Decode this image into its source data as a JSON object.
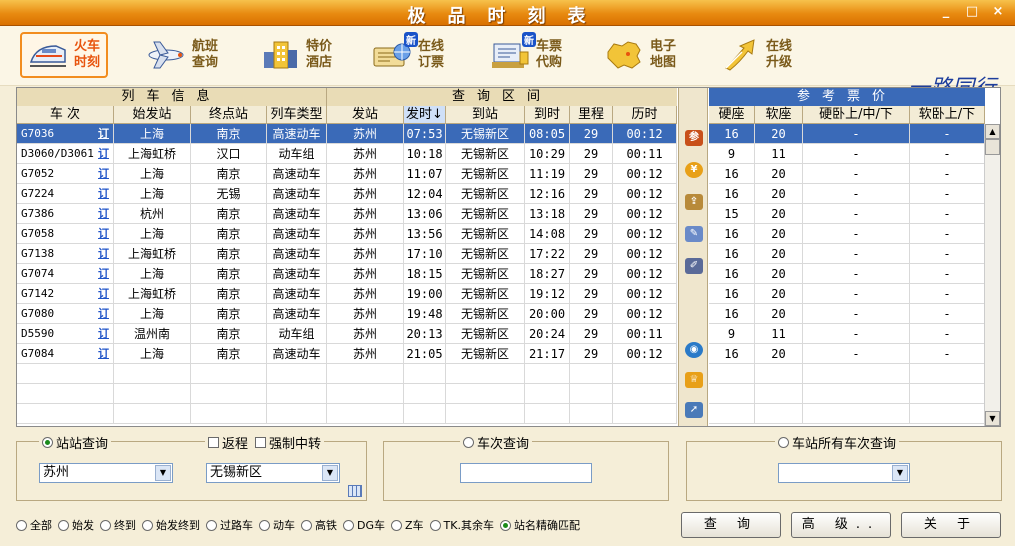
{
  "window": {
    "title": "极品时刻表",
    "controls": [
      "_",
      "□",
      "×"
    ]
  },
  "toolbar": [
    {
      "line1": "火车",
      "line2": "时刻",
      "icon": "train-icon",
      "active": true
    },
    {
      "line1": "航班",
      "line2": "查询",
      "icon": "airplane-icon"
    },
    {
      "line1": "特价",
      "line2": "酒店",
      "icon": "hotel-icon"
    },
    {
      "line1": "在线",
      "line2": "订票",
      "icon": "ticket-icon",
      "badge": "新"
    },
    {
      "line1": "车票",
      "line2": "代购",
      "icon": "cashier-icon",
      "badge": "新"
    },
    {
      "line1": "电子",
      "line2": "地图",
      "icon": "china-map-icon"
    },
    {
      "line1": "在线",
      "line2": "升级",
      "icon": "upgrade-arrow-icon"
    }
  ],
  "signature": "一路同行",
  "table": {
    "group_train": "列车信息",
    "group_query": "查询区间",
    "group_price": "参考票价",
    "columns": [
      "车 次",
      "始发站",
      "终点站",
      "列车类型",
      "发站",
      "发时↓",
      "到站",
      "到时",
      "里程",
      "历时"
    ],
    "price_columns": [
      "硬座",
      "软座",
      "硬卧上/中/下",
      "软卧上/下"
    ],
    "ding_label": "订",
    "rows": [
      [
        "G7036",
        "上海",
        "南京",
        "高速动车",
        "苏州",
        "07:53",
        "无锡新区",
        "08:05",
        "29",
        "00:12",
        "16",
        "20",
        "-",
        "-"
      ],
      [
        "D3060/D3061",
        "上海虹桥",
        "汉口",
        "动车组",
        "苏州",
        "10:18",
        "无锡新区",
        "10:29",
        "29",
        "00:11",
        "9",
        "11",
        "-",
        "-"
      ],
      [
        "G7052",
        "上海",
        "南京",
        "高速动车",
        "苏州",
        "11:07",
        "无锡新区",
        "11:19",
        "29",
        "00:12",
        "16",
        "20",
        "-",
        "-"
      ],
      [
        "G7224",
        "上海",
        "无锡",
        "高速动车",
        "苏州",
        "12:04",
        "无锡新区",
        "12:16",
        "29",
        "00:12",
        "16",
        "20",
        "-",
        "-"
      ],
      [
        "G7386",
        "杭州",
        "南京",
        "高速动车",
        "苏州",
        "13:06",
        "无锡新区",
        "13:18",
        "29",
        "00:12",
        "15",
        "20",
        "-",
        "-"
      ],
      [
        "G7058",
        "上海",
        "南京",
        "高速动车",
        "苏州",
        "13:56",
        "无锡新区",
        "14:08",
        "29",
        "00:12",
        "16",
        "20",
        "-",
        "-"
      ],
      [
        "G7138",
        "上海虹桥",
        "南京",
        "高速动车",
        "苏州",
        "17:10",
        "无锡新区",
        "17:22",
        "29",
        "00:12",
        "16",
        "20",
        "-",
        "-"
      ],
      [
        "G7074",
        "上海",
        "南京",
        "高速动车",
        "苏州",
        "18:15",
        "无锡新区",
        "18:27",
        "29",
        "00:12",
        "16",
        "20",
        "-",
        "-"
      ],
      [
        "G7142",
        "上海虹桥",
        "南京",
        "高速动车",
        "苏州",
        "19:00",
        "无锡新区",
        "19:12",
        "29",
        "00:12",
        "16",
        "20",
        "-",
        "-"
      ],
      [
        "G7080",
        "上海",
        "南京",
        "高速动车",
        "苏州",
        "19:48",
        "无锡新区",
        "20:00",
        "29",
        "00:12",
        "16",
        "20",
        "-",
        "-"
      ],
      [
        "D5590",
        "温州南",
        "南京",
        "动车组",
        "苏州",
        "20:13",
        "无锡新区",
        "20:24",
        "29",
        "00:11",
        "9",
        "11",
        "-",
        "-"
      ],
      [
        "G7084",
        "上海",
        "南京",
        "高速动车",
        "苏州",
        "21:05",
        "无锡新区",
        "21:17",
        "29",
        "00:12",
        "16",
        "20",
        "-",
        "-"
      ]
    ]
  },
  "side_icons": [
    "参",
    "¥",
    "⇪",
    "✎",
    "✐",
    "◉",
    "♕",
    "➚"
  ],
  "station_query": {
    "label": "站站查询",
    "return_label": "返程",
    "transfer_label": "强制中转",
    "from_value": "苏州",
    "to_value": "无锡新区"
  },
  "train_query": {
    "label": "车次查询",
    "value": ""
  },
  "station_all_query": {
    "label": "车站所有车次查询",
    "value": ""
  },
  "filters": [
    {
      "label": "全部",
      "on": false
    },
    {
      "label": "始发",
      "on": false
    },
    {
      "label": "终到",
      "on": false
    },
    {
      "label": "始发终到",
      "on": false
    },
    {
      "label": "过路车",
      "on": false
    },
    {
      "label": "动车",
      "on": false
    },
    {
      "label": "高铁",
      "on": false
    },
    {
      "label": "DG车",
      "on": false
    },
    {
      "label": "Z车",
      "on": false
    },
    {
      "label": "TK.其余车",
      "on": false
    },
    {
      "label": "站名精确匹配",
      "on": true
    }
  ],
  "buttons": {
    "query": "查 询",
    "advanced": "高 级..",
    "close": "关 于"
  }
}
